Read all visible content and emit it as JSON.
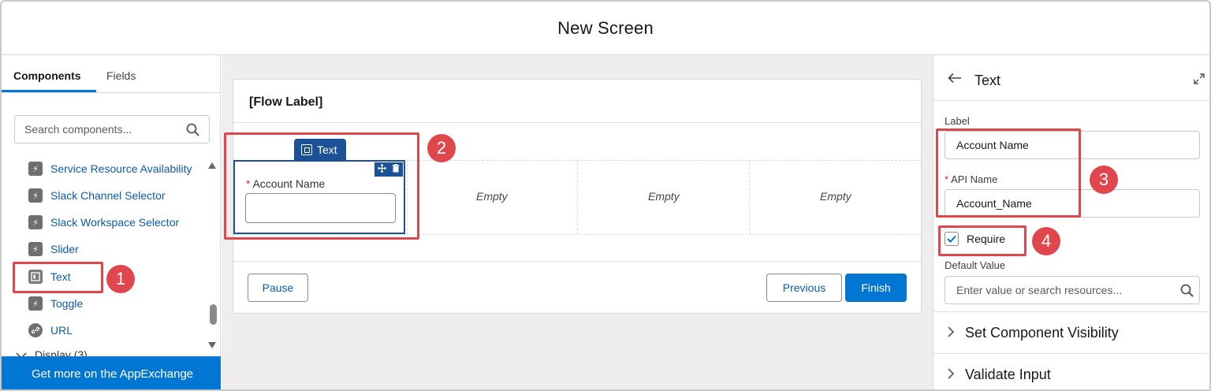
{
  "header": {
    "title": "New Screen"
  },
  "left": {
    "tabs": [
      {
        "label": "Components"
      },
      {
        "label": "Fields"
      }
    ],
    "search": {
      "placeholder": "Search components..."
    },
    "items": [
      {
        "label": "Service Resource Availability",
        "icon": "lightning-icon"
      },
      {
        "label": "Slack Channel Selector",
        "icon": "lightning-icon"
      },
      {
        "label": "Slack Workspace Selector",
        "icon": "lightning-icon"
      },
      {
        "label": "Slider",
        "icon": "lightning-icon"
      },
      {
        "label": "Text",
        "icon": "text-field-icon"
      },
      {
        "label": "Toggle",
        "icon": "lightning-icon"
      },
      {
        "label": "URL",
        "icon": "link-icon"
      }
    ],
    "display_group": "Display (3)",
    "appexchange": "Get more on the AppExchange"
  },
  "canvas": {
    "flow_label": "[Flow Label]",
    "component_badge": "Text",
    "field": {
      "required_mark": "*",
      "label": "Account Name"
    },
    "empty_columns": [
      "Empty",
      "Empty",
      "Empty"
    ],
    "buttons": {
      "pause": "Pause",
      "previous": "Previous",
      "finish": "Finish"
    }
  },
  "annotations": [
    "1",
    "2",
    "3",
    "4"
  ],
  "right": {
    "title": "Text",
    "label_caption": "Label",
    "label_value": "Account Name",
    "api_required_mark": "*",
    "api_caption": "API Name",
    "api_value": "Account_Name",
    "require_label": "Require",
    "require_checked": true,
    "default_caption": "Default Value",
    "default_placeholder": "Enter value or search resources...",
    "sections": [
      "Set Component Visibility",
      "Validate Input"
    ]
  },
  "colors": {
    "brand_blue": "#0176d3",
    "selection_blue": "#1b5297",
    "annotation_red": "#e0474c"
  }
}
